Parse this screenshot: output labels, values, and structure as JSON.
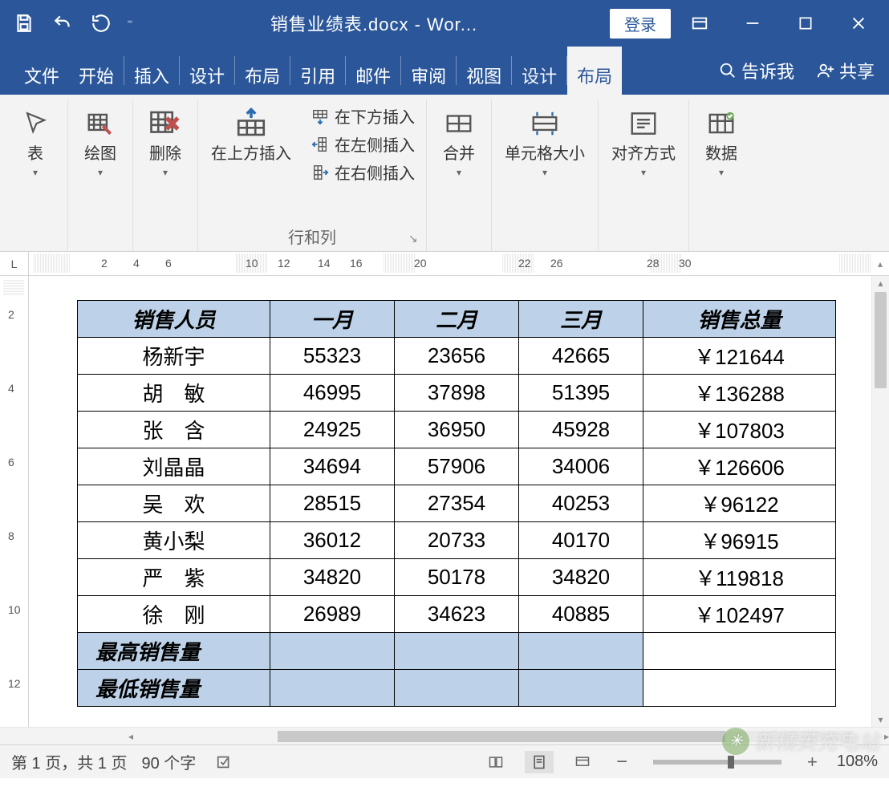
{
  "titlebar": {
    "doc_title": "销售业绩表.docx - Wor...",
    "login": "登录"
  },
  "tabs": [
    "文件",
    "开始",
    "插入",
    "设计",
    "布局",
    "引用",
    "邮件",
    "审阅",
    "视图",
    "设计",
    "布局"
  ],
  "active_tab_index": 10,
  "tell_me": "告诉我",
  "share": "共享",
  "ribbon": {
    "table": "表",
    "draw": "绘图",
    "delete": "删除",
    "insert_above": "在上方插入",
    "insert_below": "在下方插入",
    "insert_left": "在左侧插入",
    "insert_right": "在右侧插入",
    "rows_cols_group": "行和列",
    "merge": "合并",
    "cell_size": "单元格大小",
    "alignment": "对齐方式",
    "data": "数据"
  },
  "ruler_h": [
    "2",
    "4",
    "6",
    "10",
    "12",
    "14",
    "16",
    "20",
    "22",
    "26",
    "28",
    "30"
  ],
  "ruler_v": [
    "2",
    "4",
    "6",
    "8",
    "10",
    "12"
  ],
  "table": {
    "headers": [
      "销售人员",
      "一月",
      "二月",
      "三月",
      "销售总量"
    ],
    "rows": [
      {
        "name": "杨新宇",
        "spaced": false,
        "m1": "55323",
        "m2": "23656",
        "m3": "42665",
        "total": "￥121644"
      },
      {
        "name": "胡　敏",
        "spaced": false,
        "m1": "46995",
        "m2": "37898",
        "m3": "51395",
        "total": "￥136288"
      },
      {
        "name": "张　含",
        "spaced": false,
        "m1": "24925",
        "m2": "36950",
        "m3": "45928",
        "total": "￥107803"
      },
      {
        "name": "刘晶晶",
        "spaced": false,
        "m1": "34694",
        "m2": "57906",
        "m3": "34006",
        "total": "￥126606"
      },
      {
        "name": "吴　欢",
        "spaced": false,
        "m1": "28515",
        "m2": "27354",
        "m3": "40253",
        "total": "￥96122"
      },
      {
        "name": "黄小梨",
        "spaced": false,
        "m1": "36012",
        "m2": "20733",
        "m3": "40170",
        "total": "￥96915"
      },
      {
        "name": "严　紫",
        "spaced": false,
        "m1": "34820",
        "m2": "50178",
        "m3": "34820",
        "total": "￥119818"
      },
      {
        "name": "徐　刚",
        "spaced": false,
        "m1": "26989",
        "m2": "34623",
        "m3": "40885",
        "total": "￥102497"
      }
    ],
    "summary": [
      {
        "label": "最高销售量"
      },
      {
        "label": "最低销售量"
      }
    ]
  },
  "status": {
    "page": "第 1 页，共 1 页",
    "words": "90 个字",
    "zoom": "108%"
  },
  "watermark": "新精英充电站"
}
